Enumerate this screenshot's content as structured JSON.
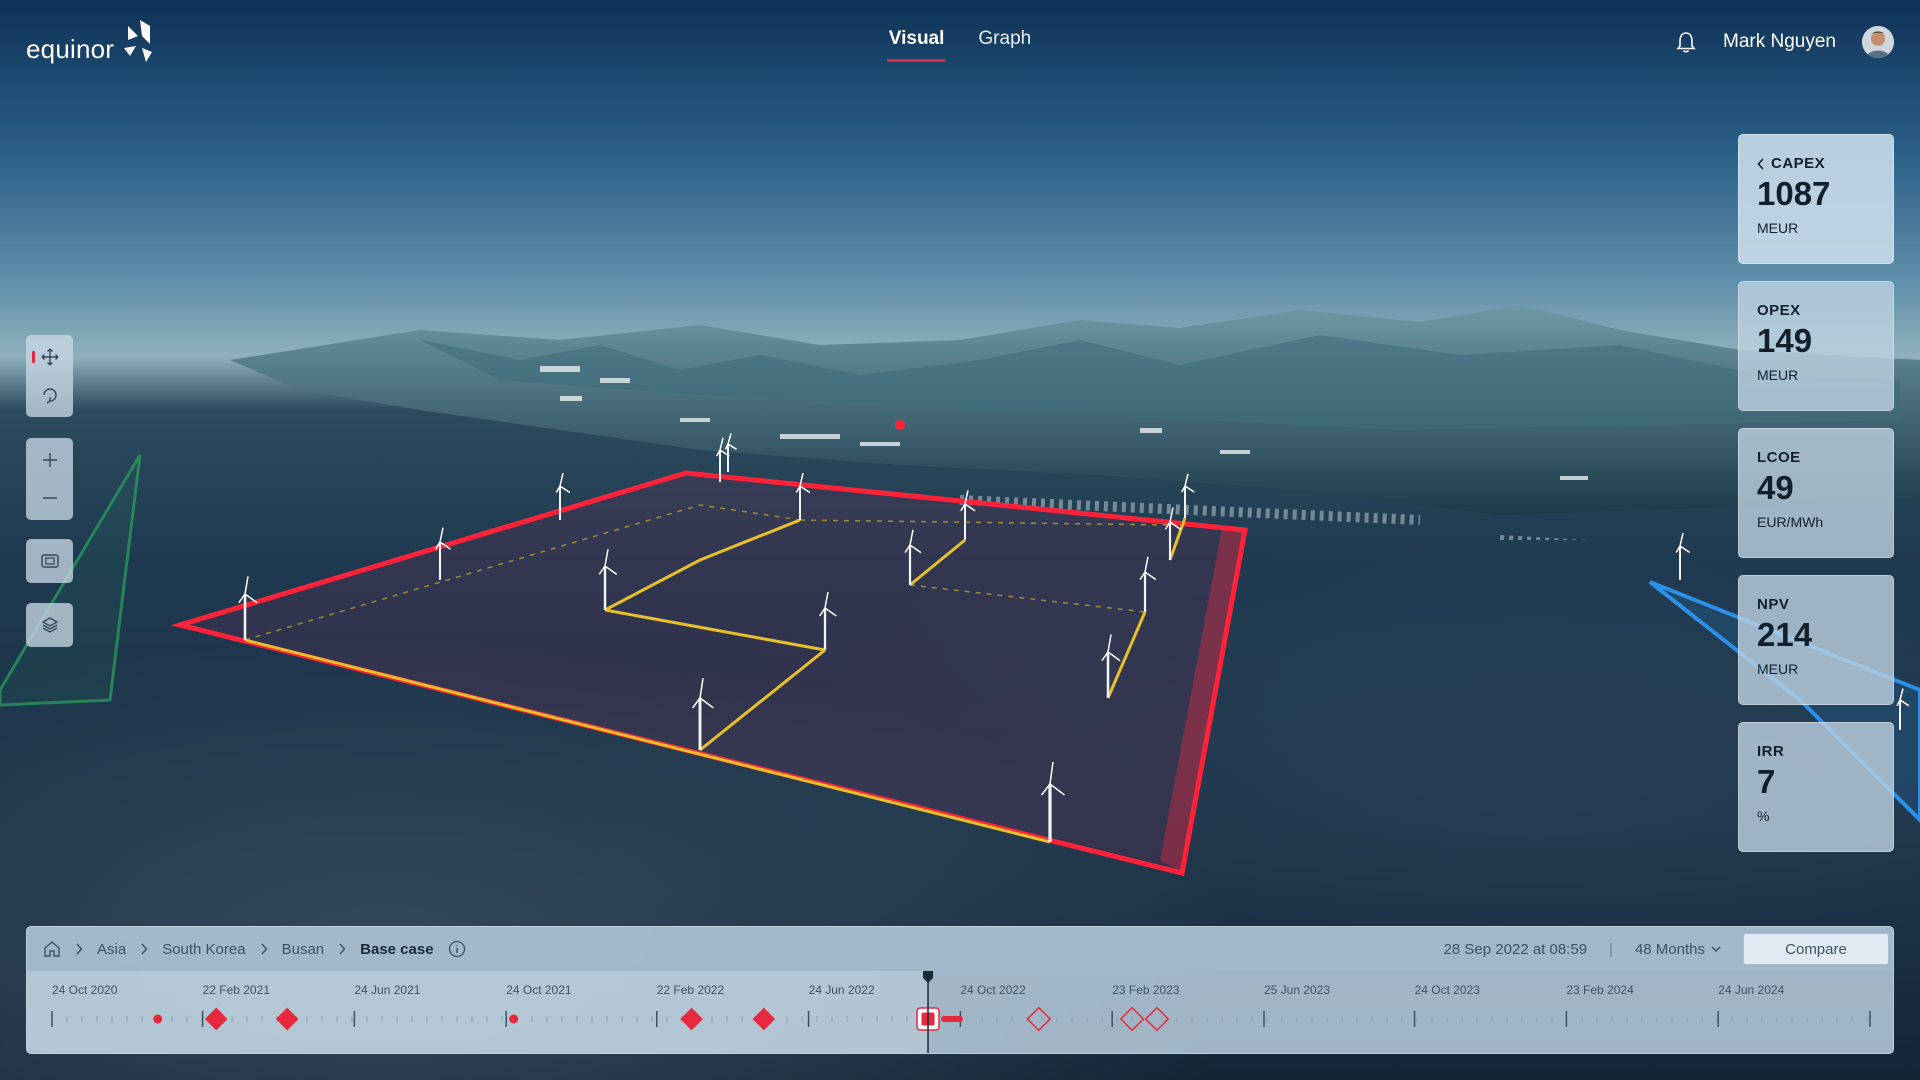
{
  "app": {
    "logo_text": "equinor",
    "user_name": "Mark Nguyen"
  },
  "nav": {
    "tabs": [
      {
        "label": "Visual",
        "active": true
      },
      {
        "label": "Graph",
        "active": false
      }
    ]
  },
  "toolbar": {
    "groups": [
      [
        "move-icon",
        "rotate-icon"
      ],
      [
        "zoom-in-icon",
        "zoom-out-icon"
      ],
      [
        "fit-view-icon"
      ],
      [
        "layers-icon"
      ]
    ]
  },
  "kpis": [
    {
      "label": "CAPEX",
      "value": "1087",
      "unit": "MEUR",
      "expandable": true
    },
    {
      "label": "OPEX",
      "value": "149",
      "unit": "MEUR"
    },
    {
      "label": "LCOE",
      "value": "49",
      "unit": "EUR/MWh"
    },
    {
      "label": "NPV",
      "value": "214",
      "unit": "MEUR"
    },
    {
      "label": "IRR",
      "value": "7",
      "unit": "%"
    }
  ],
  "breadcrumb": {
    "items": [
      "Asia",
      "South Korea",
      "Busan"
    ],
    "current": "Base case"
  },
  "timeline": {
    "timestamp": "28 Sep 2022 at 08:59",
    "period": "48 Months",
    "compare_label": "Compare",
    "dates": [
      "24 Oct 2020",
      "22 Feb 2021",
      "24 Jun 2021",
      "24 Oct 2021",
      "22 Feb 2022",
      "24 Jun 2022",
      "24 Oct 2022",
      "23 Feb 2023",
      "25 Jun 2023",
      "24 Oct 2023",
      "23 Feb 2024",
      "24 Jun 2024"
    ],
    "current_date": "28 Sep 2022",
    "milestones": [
      {
        "date": "17 Jan 2021",
        "kind": "dot",
        "state": "past"
      },
      {
        "date": "5 Mar 2021",
        "kind": "diamond",
        "state": "past"
      },
      {
        "date": "1 May 2021",
        "kind": "diamond",
        "state": "past"
      },
      {
        "date": "30 Oct 2021",
        "kind": "dot",
        "state": "past"
      },
      {
        "date": "22 Mar 2022",
        "kind": "diamond",
        "state": "past"
      },
      {
        "date": "19 May 2022",
        "kind": "diamond",
        "state": "past"
      },
      {
        "date": "28 Sep 2022",
        "kind": "square",
        "state": "current"
      },
      {
        "date": "26 Dec 2022",
        "kind": "diamond",
        "state": "future"
      },
      {
        "date": "11 Mar 2023",
        "kind": "diamond",
        "state": "future"
      },
      {
        "date": "31 Mar 2023",
        "kind": "diamond",
        "state": "future"
      }
    ]
  },
  "colors": {
    "accent": "#e8283e",
    "cable": "#e7c12a",
    "boundary": "#ff2238"
  }
}
